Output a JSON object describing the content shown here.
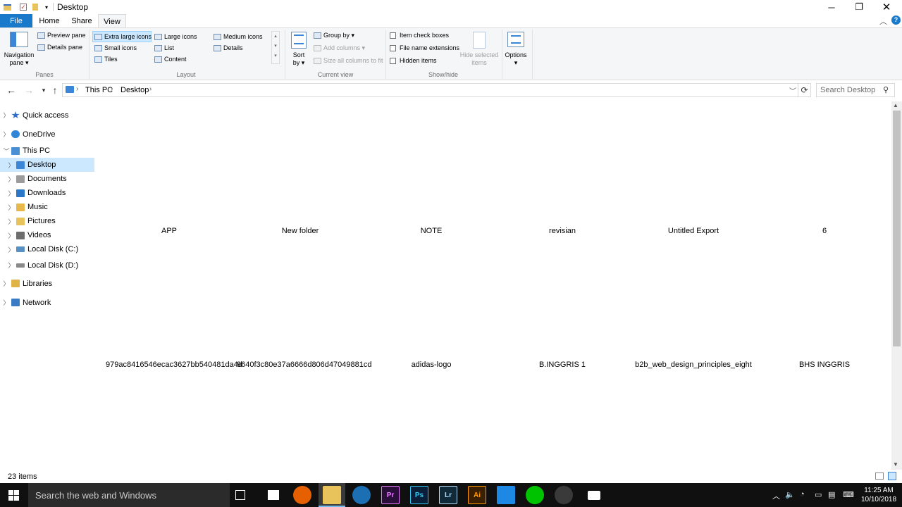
{
  "window": {
    "title": "Desktop"
  },
  "ribbon_tabs": [
    "File",
    "Home",
    "Share",
    "View"
  ],
  "ribbon": {
    "panes": {
      "label": "Panes",
      "navigation_pane": "Navigation pane",
      "preview_pane": "Preview pane",
      "details_pane": "Details pane"
    },
    "layout": {
      "label": "Layout",
      "extra_large_icons": "Extra large icons",
      "large_icons": "Large icons",
      "medium_icons": "Medium icons",
      "small_icons": "Small icons",
      "list": "List",
      "details": "Details",
      "tiles": "Tiles",
      "content": "Content"
    },
    "current_view": {
      "label": "Current view",
      "sort_by": "Sort by",
      "group_by": "Group by",
      "add_columns": "Add columns",
      "size_all_columns": "Size all columns to fit"
    },
    "show_hide": {
      "label": "Show/hide",
      "item_check_boxes": "Item check boxes",
      "file_name_extensions": "File name extensions",
      "hidden_items": "Hidden items",
      "hide_selected_items": "Hide selected items"
    },
    "options": "Options"
  },
  "address": {
    "path": [
      "This PC",
      "Desktop"
    ],
    "search_placeholder": "Search Desktop"
  },
  "nav_pane": [
    {
      "label": "Quick access",
      "color": "#2f6fc8"
    },
    {
      "label": "OneDrive",
      "color": "#2f86d8"
    },
    {
      "label": "This PC",
      "color": "#4a8fd4"
    },
    {
      "label": "Desktop",
      "color": "#3b86d6"
    },
    {
      "label": "Documents",
      "color": "#9c9c9c"
    },
    {
      "label": "Downloads",
      "color": "#2c78c8"
    },
    {
      "label": "Music",
      "color": "#e8b84a"
    },
    {
      "label": "Pictures",
      "color": "#e8c25a"
    },
    {
      "label": "Videos",
      "color": "#6d6d6d"
    },
    {
      "label": "Local Disk (C:)",
      "color": "#5a8fc4"
    },
    {
      "label": "Local Disk (D:)",
      "color": "#8a8a8a"
    },
    {
      "label": "Libraries",
      "color": "#e0b348"
    },
    {
      "label": "Network",
      "color": "#3a7cc4"
    }
  ],
  "files": [
    "APP",
    "New folder",
    "NOTE",
    "revisian",
    "Untitled Export",
    "6",
    "979ac8416546ecac3627bb540481da4d",
    "9640f3c80e37a6666d806d47049881cd",
    "adidas-logo",
    "B.INGGRIS 1",
    "b2b_web_design_principles_eight",
    "BHS INGGRIS"
  ],
  "status": {
    "item_count": "23 items"
  },
  "taskbar": {
    "search_text": "Search the web and Windows",
    "apps": [
      {
        "label": "Pr",
        "color": "#2a0f3a"
      },
      {
        "label": "Ps",
        "color": "#0a1f3a"
      },
      {
        "label": "Lr",
        "color": "#102a3a"
      },
      {
        "label": "Ai",
        "color": "#3a1f00"
      }
    ],
    "time": "11:25 AM",
    "date": "10/10/2018"
  }
}
